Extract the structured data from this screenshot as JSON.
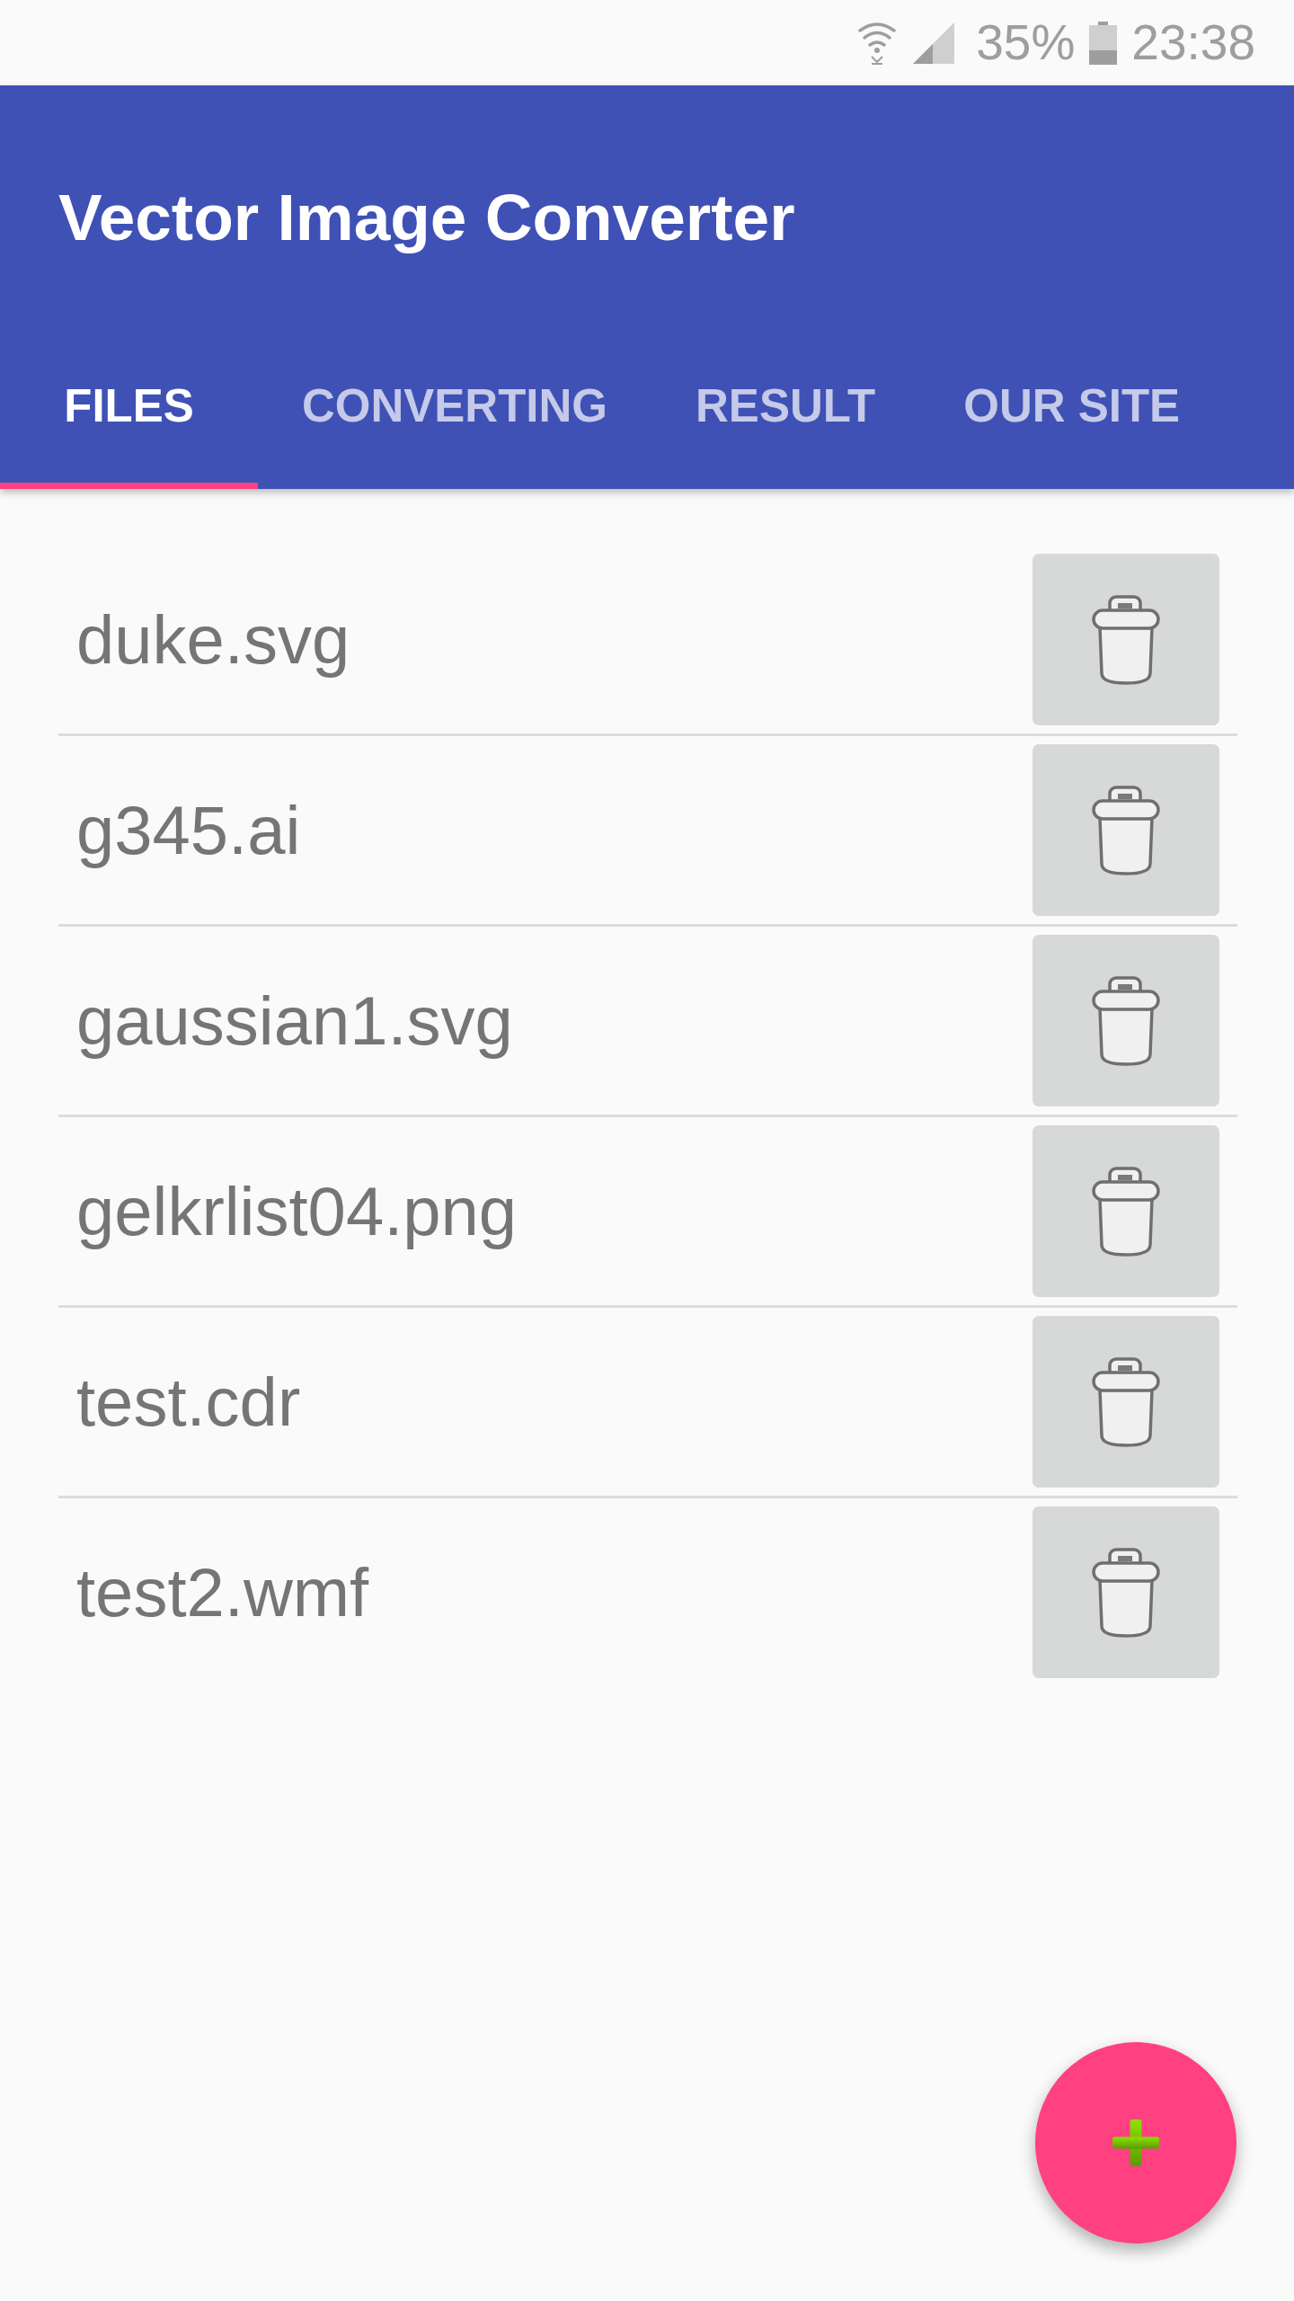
{
  "status_bar": {
    "battery": "35%",
    "time": "23:38"
  },
  "app_bar": {
    "title": "Vector Image Converter"
  },
  "tabs": [
    {
      "label": "FILES",
      "selected": true
    },
    {
      "label": "CONVERTING",
      "selected": false
    },
    {
      "label": "RESULT",
      "selected": false
    },
    {
      "label": "OUR SITE",
      "selected": false
    }
  ],
  "files": [
    "duke.svg",
    "g345.ai",
    "gaussian1.svg",
    "gelkrlist04.png",
    "test.cdr",
    "test2.wmf"
  ]
}
